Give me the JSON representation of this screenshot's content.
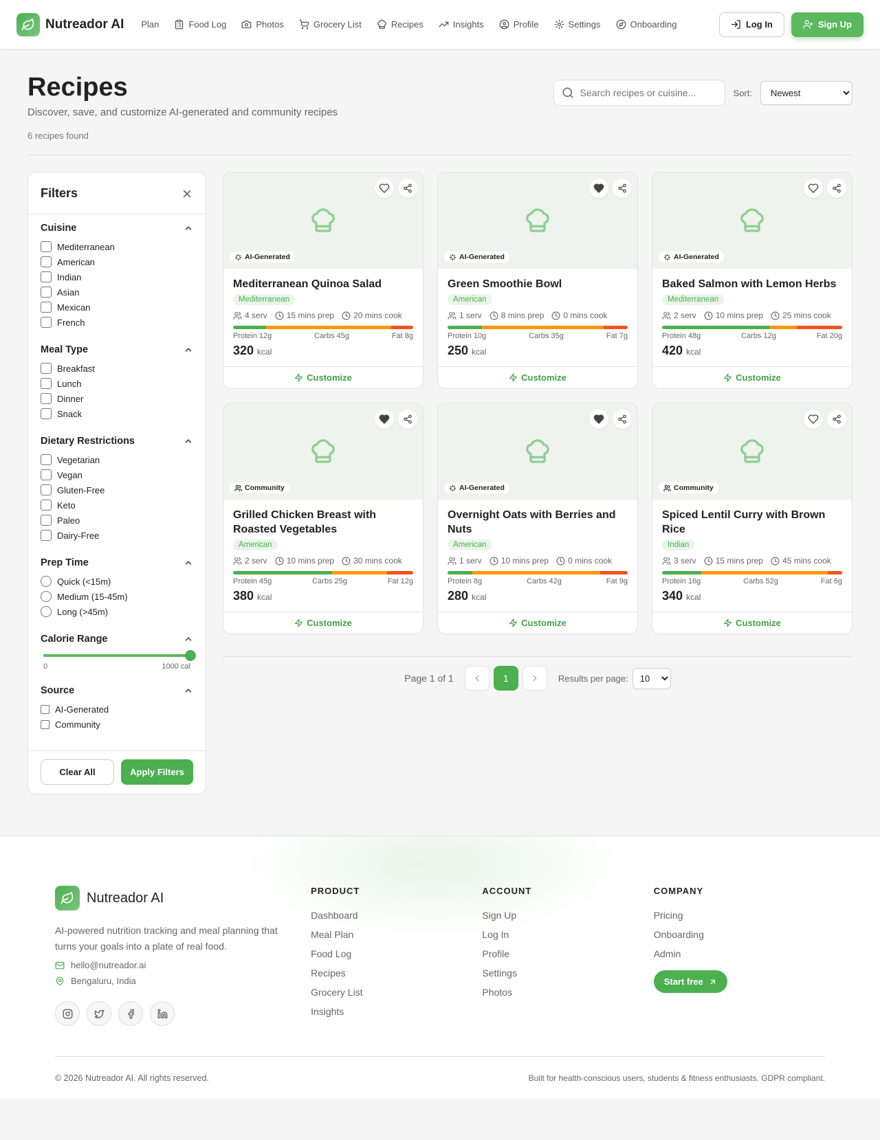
{
  "brand": {
    "name": "Nutreador AI"
  },
  "nav": {
    "items": [
      {
        "label": "Plan",
        "icon": "none"
      },
      {
        "label": "Food Log",
        "icon": "clipboard-icon"
      },
      {
        "label": "Photos",
        "icon": "camera-icon"
      },
      {
        "label": "Grocery List",
        "icon": "cart-icon"
      },
      {
        "label": "Recipes",
        "icon": "chef-hat-icon"
      },
      {
        "label": "Insights",
        "icon": "trending-up-icon"
      },
      {
        "label": "Profile",
        "icon": "user-circle-icon"
      },
      {
        "label": "Settings",
        "icon": "gear-icon"
      },
      {
        "label": "Onboarding",
        "icon": "compass-icon"
      }
    ],
    "login": "Log In",
    "signup": "Sign Up"
  },
  "page": {
    "title": "Recipes",
    "subtitle": "Discover, save, and customize AI-generated and community recipes",
    "count": "6 recipes found",
    "search_placeholder": "Search recipes or cuisine...",
    "sort_label": "Sort:",
    "sort_value": "Newest"
  },
  "filters": {
    "title": "Filters",
    "cuisine": {
      "title": "Cuisine",
      "options": [
        "Mediterranean",
        "American",
        "Indian",
        "Asian",
        "Mexican",
        "French"
      ]
    },
    "meal_type": {
      "title": "Meal Type",
      "options": [
        "Breakfast",
        "Lunch",
        "Dinner",
        "Snack"
      ]
    },
    "dietary": {
      "title": "Dietary Restrictions",
      "options": [
        "Vegetarian",
        "Vegan",
        "Gluten-Free",
        "Keto",
        "Paleo",
        "Dairy-Free"
      ]
    },
    "prep_time": {
      "title": "Prep Time",
      "options": [
        "Quick (<15m)",
        "Medium (15-45m)",
        "Long (>45m)"
      ]
    },
    "calorie": {
      "title": "Calorie Range",
      "min_label": "0",
      "max_label": "1000 cal",
      "value_fraction": 1.0
    },
    "source": {
      "title": "Source",
      "options": [
        "AI-Generated",
        "Community"
      ]
    },
    "clear": "Clear All",
    "apply": "Apply Filters"
  },
  "recipes": [
    {
      "title": "Mediterranean Quinoa Salad",
      "source": "AI-Generated",
      "cuisine": "Mediterranean",
      "servings": "4 serv",
      "prep": "15 mins prep",
      "cook": "20 mins cook",
      "protein": "Protein 12g",
      "carbs": "Carbs 45g",
      "fat": "Fat 8g",
      "protein_g": 12,
      "carbs_g": 45,
      "fat_g": 8,
      "kcal": "320",
      "kcal_unit": "kcal",
      "favorite": false,
      "customize": "Customize"
    },
    {
      "title": "Green Smoothie Bowl",
      "source": "AI-Generated",
      "cuisine": "American",
      "servings": "1 serv",
      "prep": "8 mins prep",
      "cook": "0 mins cook",
      "protein": "Protein 10g",
      "carbs": "Carbs 35g",
      "fat": "Fat 7g",
      "protein_g": 10,
      "carbs_g": 35,
      "fat_g": 7,
      "kcal": "250",
      "kcal_unit": "kcal",
      "favorite": true,
      "customize": "Customize"
    },
    {
      "title": "Baked Salmon with Lemon Herbs",
      "source": "AI-Generated",
      "cuisine": "Mediterranean",
      "servings": "2 serv",
      "prep": "10 mins prep",
      "cook": "25 mins cook",
      "protein": "Protein 48g",
      "carbs": "Carbs 12g",
      "fat": "Fat 20g",
      "protein_g": 48,
      "carbs_g": 12,
      "fat_g": 20,
      "kcal": "420",
      "kcal_unit": "kcal",
      "favorite": false,
      "customize": "Customize"
    },
    {
      "title": "Grilled Chicken Breast with Roasted Vegetables",
      "source": "Community",
      "cuisine": "American",
      "servings": "2 serv",
      "prep": "10 mins prep",
      "cook": "30 mins cook",
      "protein": "Protein 45g",
      "carbs": "Carbs 25g",
      "fat": "Fat 12g",
      "protein_g": 45,
      "carbs_g": 25,
      "fat_g": 12,
      "kcal": "380",
      "kcal_unit": "kcal",
      "favorite": true,
      "customize": "Customize"
    },
    {
      "title": "Overnight Oats with Berries and Nuts",
      "source": "AI-Generated",
      "cuisine": "American",
      "servings": "1 serv",
      "prep": "10 mins prep",
      "cook": "0 mins cook",
      "protein": "Protein 8g",
      "carbs": "Carbs 42g",
      "fat": "Fat 9g",
      "protein_g": 8,
      "carbs_g": 42,
      "fat_g": 9,
      "kcal": "280",
      "kcal_unit": "kcal",
      "favorite": true,
      "customize": "Customize"
    },
    {
      "title": "Spiced Lentil Curry with Brown Rice",
      "source": "Community",
      "cuisine": "Indian",
      "servings": "3 serv",
      "prep": "15 mins prep",
      "cook": "45 mins cook",
      "protein": "Protein 16g",
      "carbs": "Carbs 52g",
      "fat": "Fat 6g",
      "protein_g": 16,
      "carbs_g": 52,
      "fat_g": 6,
      "kcal": "340",
      "kcal_unit": "kcal",
      "favorite": false,
      "customize": "Customize"
    }
  ],
  "pagination": {
    "text": "Page 1 of 1",
    "current": "1",
    "per_page_label": "Results per page:",
    "per_page": "10"
  },
  "footer": {
    "brand": "Nutreador AI",
    "description": "AI-powered nutrition tracking and meal planning that turns your goals into a plate of real food.",
    "email": "hello@nutreador.ai",
    "location": "Bengaluru, India",
    "socials": [
      "instagram-icon",
      "twitter-icon",
      "facebook-icon",
      "linkedin-icon"
    ],
    "product": {
      "title": "PRODUCT",
      "links": [
        "Dashboard",
        "Meal Plan",
        "Food Log",
        "Recipes",
        "Grocery List",
        "Insights"
      ]
    },
    "account": {
      "title": "ACCOUNT",
      "links": [
        "Sign Up",
        "Log In",
        "Profile",
        "Settings",
        "Photos"
      ]
    },
    "company": {
      "title": "COMPANY",
      "links": [
        "Pricing",
        "Onboarding",
        "Admin"
      ],
      "cta": "Start free"
    },
    "copyright": "© 2026 Nutreador AI. All rights reserved.",
    "tagline": "Built for health-conscious users, students & fitness enthusiasts. GDPR compliant."
  },
  "colors": {
    "accent": "#4caf50",
    "protein": "#4caf50",
    "carbs": "#ff9800",
    "fat": "#f4511e"
  }
}
